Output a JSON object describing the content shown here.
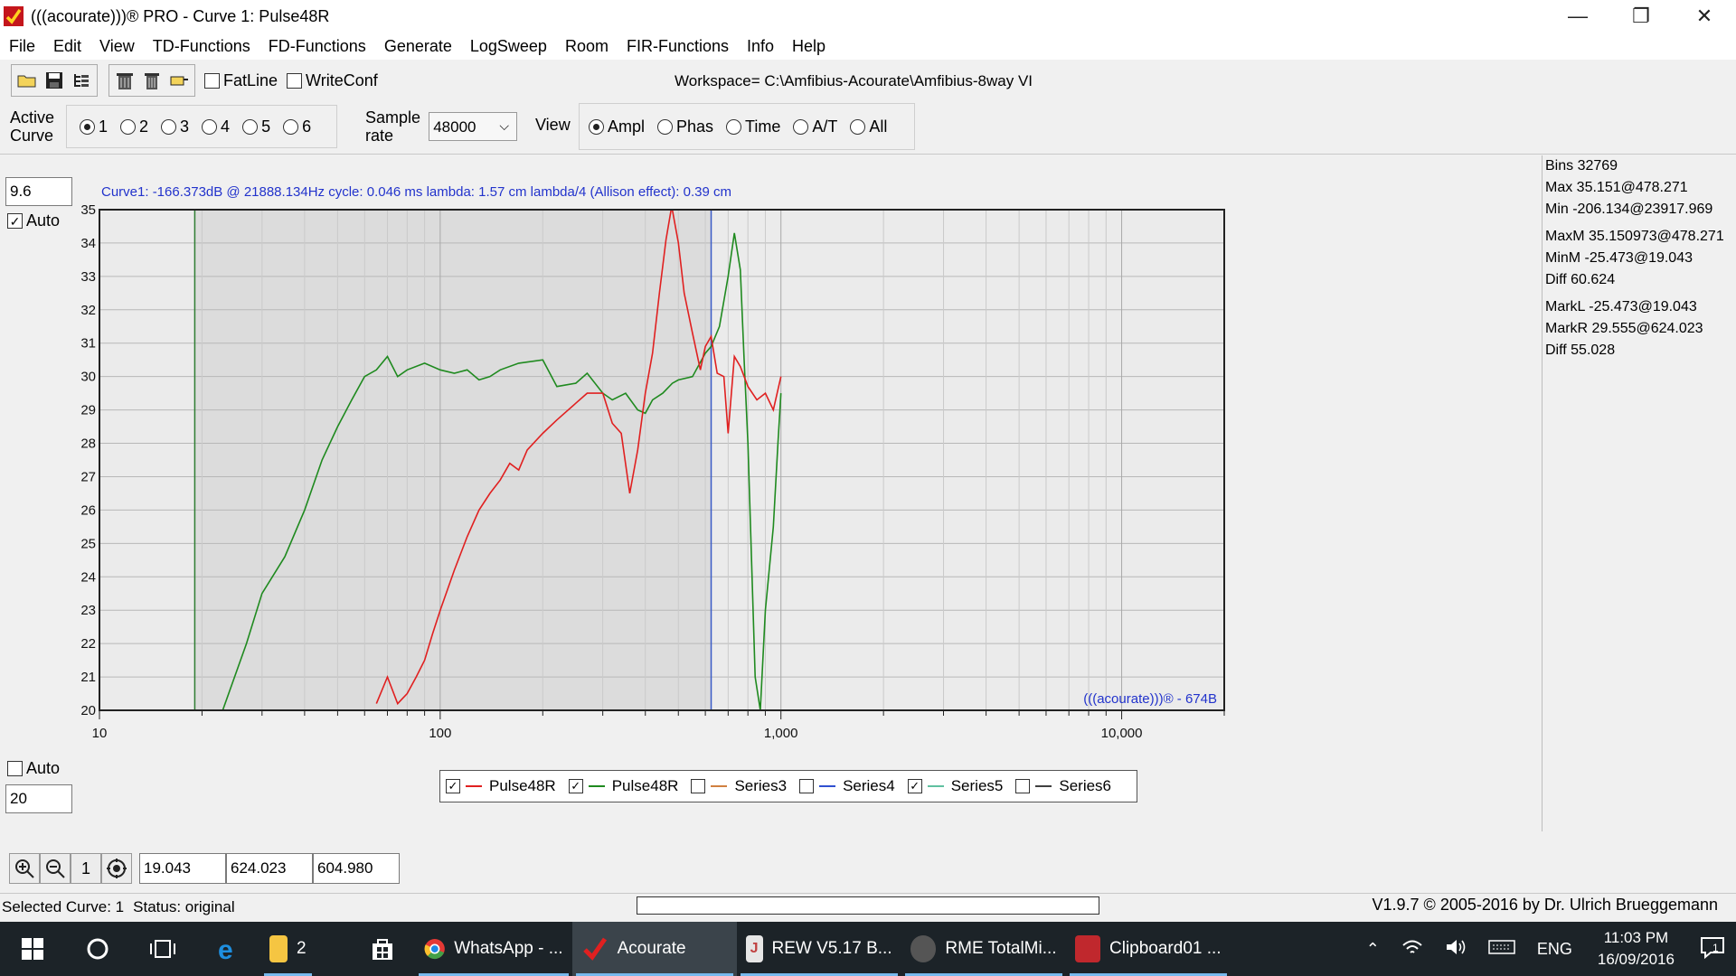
{
  "window": {
    "title": "(((acourate)))® PRO - Curve 1: Pulse48R",
    "controls": {
      "minimize": "—",
      "maximize": "❐",
      "close": "✕"
    }
  },
  "menu": [
    "File",
    "Edit",
    "View",
    "TD-Functions",
    "FD-Functions",
    "Generate",
    "LogSweep",
    "Room",
    "FIR-Functions",
    "Info",
    "Help"
  ],
  "toolbar": {
    "fatline_label": "FatLine",
    "writeconf_label": "WriteConf",
    "fatline_checked": false,
    "writeconf_checked": false,
    "workspace": "Workspace= C:\\Amfibius-Acourate\\Amfibius-8way VI"
  },
  "settings": {
    "active_curve_label_1": "Active",
    "active_curve_label_2": "Curve",
    "curves": [
      "1",
      "2",
      "3",
      "4",
      "5",
      "6"
    ],
    "selected_curve": "1",
    "sample_rate_label_1": "Sample",
    "sample_rate_label_2": "rate",
    "sample_rate": "48000",
    "view_label": "View",
    "views": [
      "Ampl",
      "Phas",
      "Time",
      "A/T",
      "All"
    ],
    "selected_view": "Ampl"
  },
  "left_panel": {
    "top_value": "9.6",
    "top_auto_label": "Auto",
    "top_auto_checked": true,
    "bottom_auto_label": "Auto",
    "bottom_auto_checked": false,
    "bottom_value": "20"
  },
  "info_line": "Curve1:  -166.373dB @ 21888.134Hz   cycle: 0.046 ms   lambda: 1.57 cm   lambda/4 (Allison effect): 0.39 cm",
  "stats": {
    "bins": "Bins 32769",
    "max": "Max 35.151@478.271",
    "min": "Min -206.134@23917.969",
    "maxm": "MaxM 35.150973@478.271",
    "minm": "MinM -25.473@19.043",
    "diff1": "Diff 60.624",
    "markl": "MarkL -25.473@19.043",
    "markr": "MarkR 29.555@624.023",
    "diff2": "Diff 55.028"
  },
  "watermark": "(((acourate)))® - 674B",
  "legend": [
    {
      "name": "Pulse48R",
      "checked": true,
      "color": "#e02020"
    },
    {
      "name": "Pulse48R",
      "checked": true,
      "color": "#1f8a1f"
    },
    {
      "name": "Series3",
      "checked": false,
      "color": "#d08040"
    },
    {
      "name": "Series4",
      "checked": false,
      "color": "#3050d0"
    },
    {
      "name": "Series5",
      "checked": true,
      "color": "#60c0a0"
    },
    {
      "name": "Series6",
      "checked": false,
      "color": "#404040"
    }
  ],
  "chart_data": {
    "type": "line",
    "x_scale": "log",
    "xlim": [
      10,
      20000
    ],
    "ylim": [
      20,
      35
    ],
    "x_ticks": [
      "10",
      "100",
      "1,000",
      "10,000"
    ],
    "y_ticks": [
      "20",
      "21",
      "22",
      "23",
      "24",
      "25",
      "26",
      "27",
      "28",
      "29",
      "30",
      "31",
      "32",
      "33",
      "34",
      "35"
    ],
    "grid": true,
    "markers": {
      "left_hz": 19.043,
      "right_hz": 624.023
    },
    "series": [
      {
        "name": "Pulse48R",
        "color": "#1f8a1f",
        "x": [
          23,
          27,
          30,
          35,
          40,
          45,
          50,
          55,
          60,
          65,
          70,
          75,
          80,
          90,
          100,
          110,
          120,
          130,
          140,
          150,
          170,
          200,
          220,
          250,
          270,
          300,
          320,
          350,
          380,
          400,
          420,
          450,
          480,
          500,
          550,
          600,
          624,
          660,
          700,
          730,
          760,
          780,
          800,
          820,
          840,
          870,
          900,
          950,
          980,
          1000
        ],
        "y": [
          20,
          22,
          23.5,
          24.6,
          26,
          27.5,
          28.5,
          29.3,
          30,
          30.2,
          30.6,
          30,
          30.2,
          30.4,
          30.2,
          30.1,
          30.2,
          29.9,
          30,
          30.2,
          30.4,
          30.5,
          29.7,
          29.8,
          30.1,
          29.5,
          29.3,
          29.5,
          29.0,
          28.9,
          29.3,
          29.5,
          29.8,
          29.9,
          30,
          30.7,
          30.9,
          31.5,
          33.0,
          34.3,
          33.2,
          30.5,
          28,
          24.5,
          21,
          20,
          23,
          25.5,
          28,
          29.5
        ]
      },
      {
        "name": "Pulse48R",
        "color": "#e02020",
        "x": [
          65,
          70,
          75,
          80,
          85,
          90,
          95,
          100,
          110,
          120,
          130,
          140,
          150,
          160,
          170,
          180,
          200,
          220,
          250,
          270,
          300,
          320,
          340,
          360,
          380,
          400,
          420,
          440,
          460,
          478,
          500,
          520,
          550,
          580,
          600,
          624,
          650,
          680,
          700,
          730,
          760,
          800,
          850,
          900,
          950,
          1000
        ],
        "y": [
          20.2,
          21,
          20.2,
          20.5,
          21,
          21.5,
          22.3,
          23,
          24.2,
          25.2,
          26,
          26.5,
          26.9,
          27.4,
          27.2,
          27.8,
          28.3,
          28.7,
          29.2,
          29.5,
          29.5,
          28.6,
          28.3,
          26.5,
          27.8,
          29.5,
          30.7,
          32.5,
          34.1,
          35.1,
          34,
          32.5,
          31.3,
          30.2,
          30.9,
          31.2,
          30.1,
          30,
          28.3,
          30.6,
          30.3,
          29.7,
          29.3,
          29.5,
          29,
          30
        ]
      }
    ]
  },
  "cursor_values": [
    "19.043",
    "624.023",
    "604.980"
  ],
  "zoom_reset_label": "1",
  "status": {
    "selected_curve": "Selected Curve: 1",
    "status": "Status: original",
    "copyright": "V1.9.7 © 2005-2016 by Dr. Ulrich Brueggemann"
  },
  "taskbar": {
    "apps": [
      {
        "label": "2",
        "color": "#f5c542",
        "icon": ""
      },
      {
        "label": "WhatsApp - ...",
        "color": "#ffffff",
        "icon": ""
      },
      {
        "label": "Acourate",
        "color": "#e02020",
        "icon": ""
      },
      {
        "label": "REW V5.17 B...",
        "color": "#e6e6e6",
        "icon": ""
      },
      {
        "label": "RME TotalMi...",
        "color": "#444444",
        "icon": ""
      },
      {
        "label": "Clipboard01 ...",
        "color": "#c0282d",
        "icon": ""
      }
    ],
    "language": "ENG",
    "time": "11:03 PM",
    "date": "16/09/2016",
    "notification_count": "1"
  }
}
